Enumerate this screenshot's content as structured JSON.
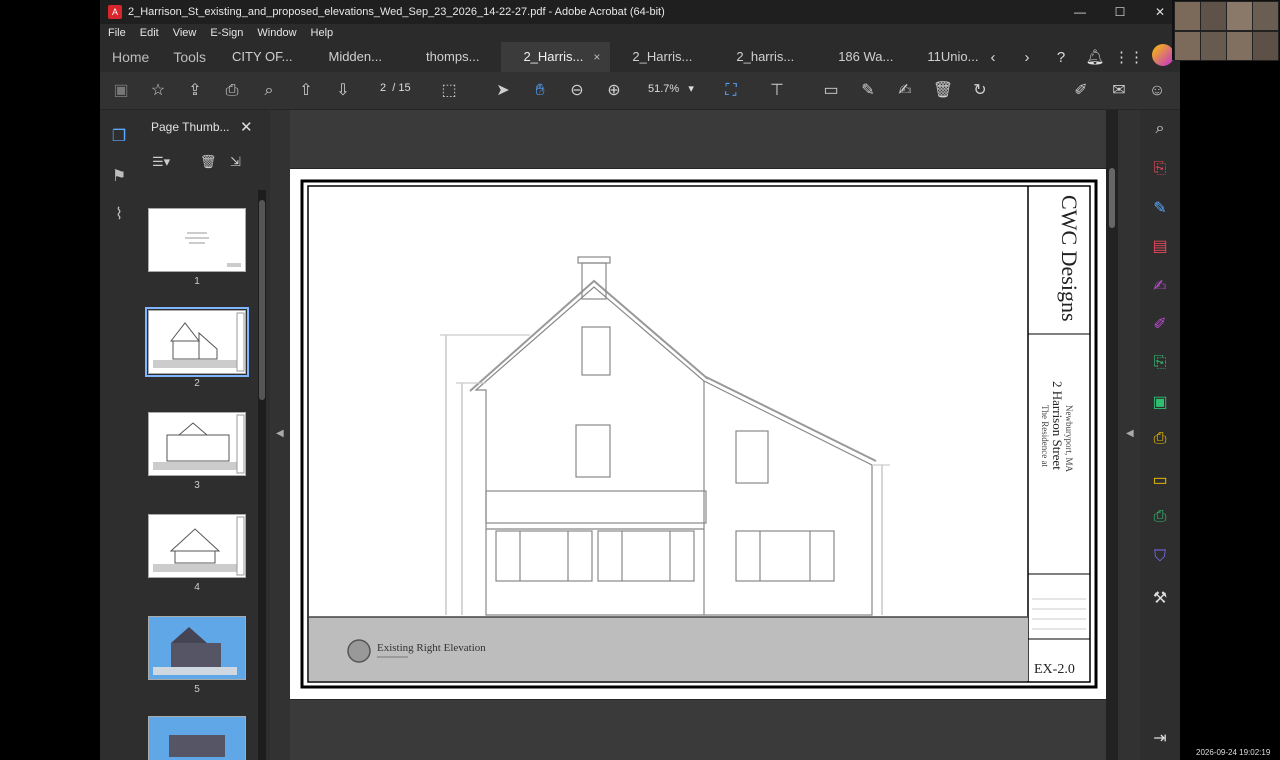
{
  "window": {
    "title": "2_Harrison_St_existing_and_proposed_elevations_Wed_Sep_23_2026_14-22-27.pdf - Adobe Acrobat (64-bit)",
    "controls": [
      "—",
      "☐",
      "✕"
    ]
  },
  "menu": [
    "File",
    "Edit",
    "View",
    "E-Sign",
    "Window",
    "Help"
  ],
  "tabs": {
    "home": "Home",
    "tools": "Tools",
    "docs": [
      {
        "label": "CITY OF...",
        "active": false
      },
      {
        "label": "Midden...",
        "active": false
      },
      {
        "label": "thomps...",
        "active": false
      },
      {
        "label": "2_Harris...",
        "active": true
      },
      {
        "label": "2_Harris...",
        "active": false
      },
      {
        "label": "2_harris...",
        "active": false
      },
      {
        "label": "186 Wa...",
        "active": false
      },
      {
        "label": "11Unio...",
        "active": false
      }
    ],
    "close_glyph": "×"
  },
  "toolbar": {
    "page_current": "2",
    "page_total": "/ 15",
    "zoom": "51.7%"
  },
  "thumbnails": {
    "header": "Page Thumb...",
    "close": "✕",
    "pages": [
      {
        "num": "1",
        "selected": false,
        "blue": false
      },
      {
        "num": "2",
        "selected": true,
        "blue": false
      },
      {
        "num": "3",
        "selected": false,
        "blue": false
      },
      {
        "num": "4",
        "selected": false,
        "blue": false
      },
      {
        "num": "5",
        "selected": false,
        "blue": true
      },
      {
        "num": "",
        "selected": false,
        "blue": true
      }
    ]
  },
  "drawing": {
    "firm": "CWC Designs",
    "residence_label": "The Residence at",
    "street": "2 Harrison Street",
    "town": "Newburyport, MA",
    "view_label": "Existing Right Elevation",
    "sheet": "EX-2.0"
  },
  "timestamp": "2026-09-24 19:02:19",
  "icons": {
    "left_rail": [
      "pages-icon",
      "bookmark-icon",
      "attachment-icon"
    ],
    "right_rail": [
      "zoom-icon",
      "export-pdf-icon",
      "edit-pdf-icon",
      "organize-icon",
      "fill-sign-icon",
      "edit-icon",
      "compress-icon",
      "scan-icon",
      "create-pdf-icon",
      "comment-icon",
      "print-icon",
      "protect-icon",
      "tools-icon"
    ]
  },
  "colors": {
    "accent": "#5aa9ff",
    "pdf_red": "#d9262c"
  }
}
